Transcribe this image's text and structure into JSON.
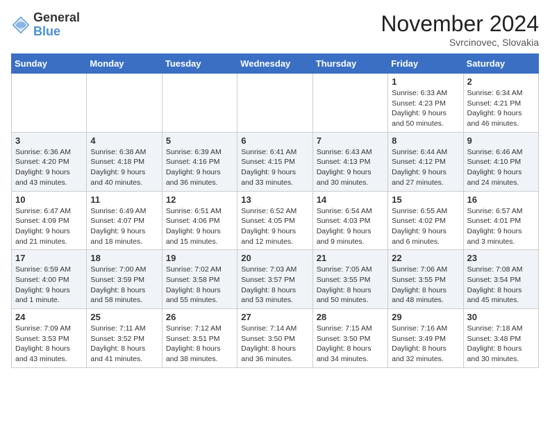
{
  "header": {
    "logo_general": "General",
    "logo_blue": "Blue",
    "month_title": "November 2024",
    "location": "Svrcinovec, Slovakia"
  },
  "days_of_week": [
    "Sunday",
    "Monday",
    "Tuesday",
    "Wednesday",
    "Thursday",
    "Friday",
    "Saturday"
  ],
  "weeks": [
    [
      {
        "day": "",
        "info": ""
      },
      {
        "day": "",
        "info": ""
      },
      {
        "day": "",
        "info": ""
      },
      {
        "day": "",
        "info": ""
      },
      {
        "day": "",
        "info": ""
      },
      {
        "day": "1",
        "info": "Sunrise: 6:33 AM\nSunset: 4:23 PM\nDaylight: 9 hours\nand 50 minutes."
      },
      {
        "day": "2",
        "info": "Sunrise: 6:34 AM\nSunset: 4:21 PM\nDaylight: 9 hours\nand 46 minutes."
      }
    ],
    [
      {
        "day": "3",
        "info": "Sunrise: 6:36 AM\nSunset: 4:20 PM\nDaylight: 9 hours\nand 43 minutes."
      },
      {
        "day": "4",
        "info": "Sunrise: 6:38 AM\nSunset: 4:18 PM\nDaylight: 9 hours\nand 40 minutes."
      },
      {
        "day": "5",
        "info": "Sunrise: 6:39 AM\nSunset: 4:16 PM\nDaylight: 9 hours\nand 36 minutes."
      },
      {
        "day": "6",
        "info": "Sunrise: 6:41 AM\nSunset: 4:15 PM\nDaylight: 9 hours\nand 33 minutes."
      },
      {
        "day": "7",
        "info": "Sunrise: 6:43 AM\nSunset: 4:13 PM\nDaylight: 9 hours\nand 30 minutes."
      },
      {
        "day": "8",
        "info": "Sunrise: 6:44 AM\nSunset: 4:12 PM\nDaylight: 9 hours\nand 27 minutes."
      },
      {
        "day": "9",
        "info": "Sunrise: 6:46 AM\nSunset: 4:10 PM\nDaylight: 9 hours\nand 24 minutes."
      }
    ],
    [
      {
        "day": "10",
        "info": "Sunrise: 6:47 AM\nSunset: 4:09 PM\nDaylight: 9 hours\nand 21 minutes."
      },
      {
        "day": "11",
        "info": "Sunrise: 6:49 AM\nSunset: 4:07 PM\nDaylight: 9 hours\nand 18 minutes."
      },
      {
        "day": "12",
        "info": "Sunrise: 6:51 AM\nSunset: 4:06 PM\nDaylight: 9 hours\nand 15 minutes."
      },
      {
        "day": "13",
        "info": "Sunrise: 6:52 AM\nSunset: 4:05 PM\nDaylight: 9 hours\nand 12 minutes."
      },
      {
        "day": "14",
        "info": "Sunrise: 6:54 AM\nSunset: 4:03 PM\nDaylight: 9 hours\nand 9 minutes."
      },
      {
        "day": "15",
        "info": "Sunrise: 6:55 AM\nSunset: 4:02 PM\nDaylight: 9 hours\nand 6 minutes."
      },
      {
        "day": "16",
        "info": "Sunrise: 6:57 AM\nSunset: 4:01 PM\nDaylight: 9 hours\nand 3 minutes."
      }
    ],
    [
      {
        "day": "17",
        "info": "Sunrise: 6:59 AM\nSunset: 4:00 PM\nDaylight: 9 hours\nand 1 minute."
      },
      {
        "day": "18",
        "info": "Sunrise: 7:00 AM\nSunset: 3:59 PM\nDaylight: 8 hours\nand 58 minutes."
      },
      {
        "day": "19",
        "info": "Sunrise: 7:02 AM\nSunset: 3:58 PM\nDaylight: 8 hours\nand 55 minutes."
      },
      {
        "day": "20",
        "info": "Sunrise: 7:03 AM\nSunset: 3:57 PM\nDaylight: 8 hours\nand 53 minutes."
      },
      {
        "day": "21",
        "info": "Sunrise: 7:05 AM\nSunset: 3:55 PM\nDaylight: 8 hours\nand 50 minutes."
      },
      {
        "day": "22",
        "info": "Sunrise: 7:06 AM\nSunset: 3:55 PM\nDaylight: 8 hours\nand 48 minutes."
      },
      {
        "day": "23",
        "info": "Sunrise: 7:08 AM\nSunset: 3:54 PM\nDaylight: 8 hours\nand 45 minutes."
      }
    ],
    [
      {
        "day": "24",
        "info": "Sunrise: 7:09 AM\nSunset: 3:53 PM\nDaylight: 8 hours\nand 43 minutes."
      },
      {
        "day": "25",
        "info": "Sunrise: 7:11 AM\nSunset: 3:52 PM\nDaylight: 8 hours\nand 41 minutes."
      },
      {
        "day": "26",
        "info": "Sunrise: 7:12 AM\nSunset: 3:51 PM\nDaylight: 8 hours\nand 38 minutes."
      },
      {
        "day": "27",
        "info": "Sunrise: 7:14 AM\nSunset: 3:50 PM\nDaylight: 8 hours\nand 36 minutes."
      },
      {
        "day": "28",
        "info": "Sunrise: 7:15 AM\nSunset: 3:50 PM\nDaylight: 8 hours\nand 34 minutes."
      },
      {
        "day": "29",
        "info": "Sunrise: 7:16 AM\nSunset: 3:49 PM\nDaylight: 8 hours\nand 32 minutes."
      },
      {
        "day": "30",
        "info": "Sunrise: 7:18 AM\nSunset: 3:48 PM\nDaylight: 8 hours\nand 30 minutes."
      }
    ]
  ]
}
